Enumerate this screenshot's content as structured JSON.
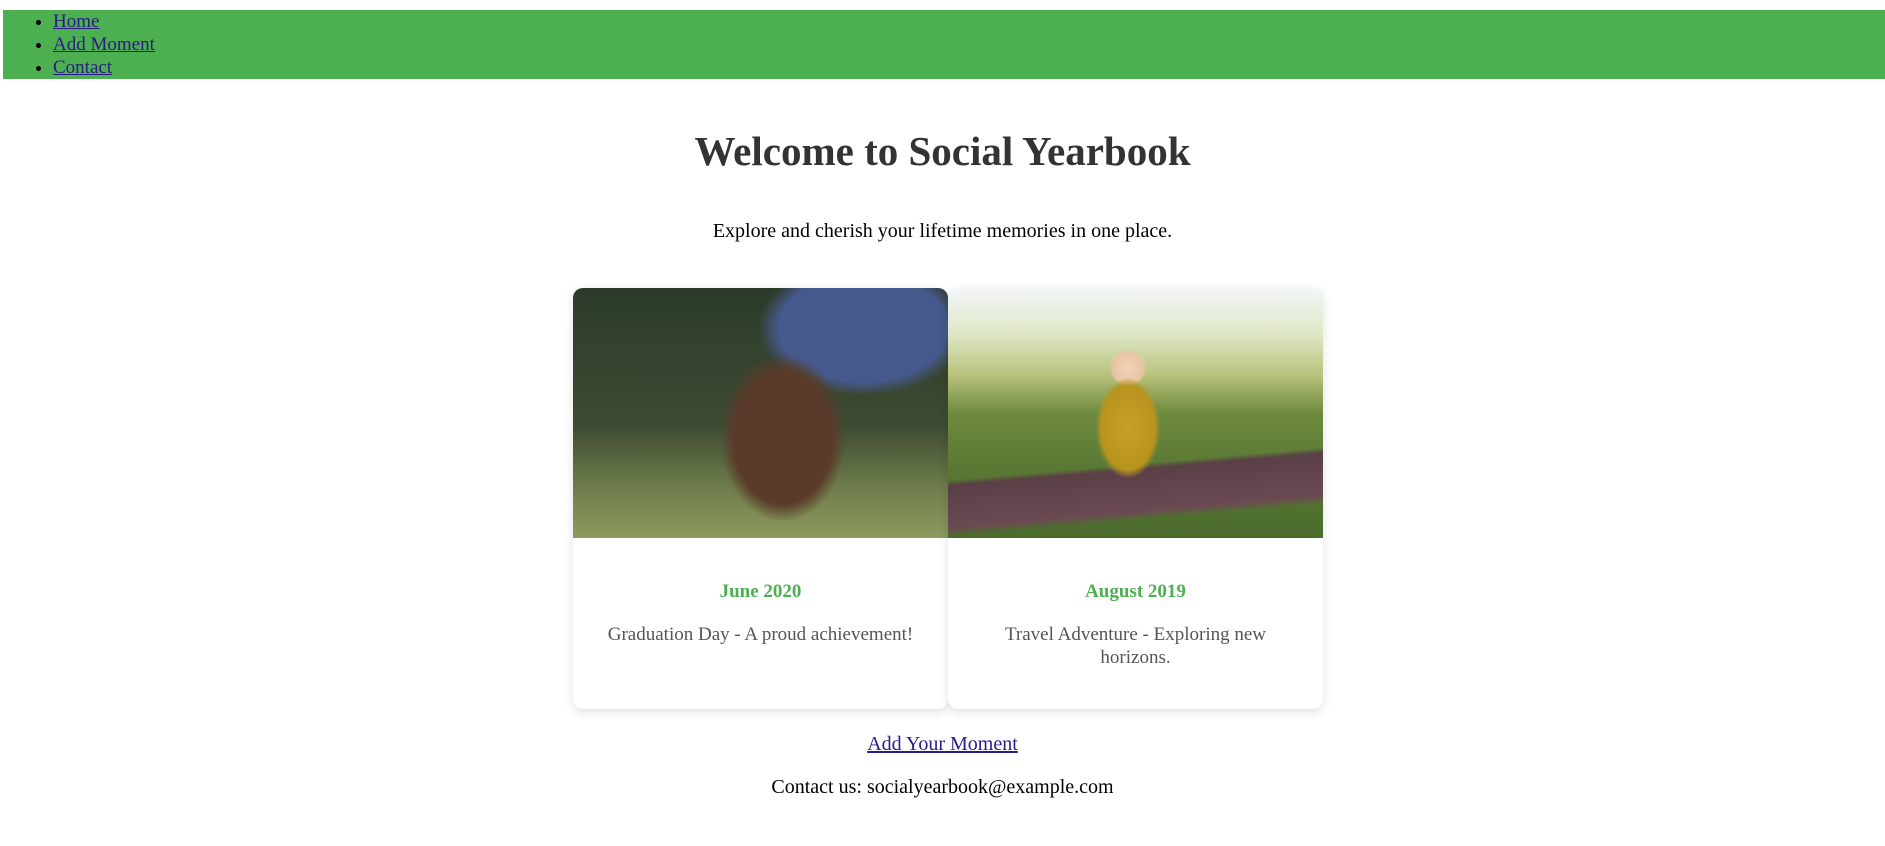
{
  "nav": {
    "items": [
      {
        "label": "Home"
      },
      {
        "label": "Add Moment"
      },
      {
        "label": "Contact"
      }
    ],
    "background_color": "#4caf50",
    "link_color": "#2b1a8a"
  },
  "header": {
    "title": "Welcome to Social Yearbook",
    "subtitle": "Explore and cherish your lifetime memories in one place."
  },
  "moments": [
    {
      "date": "June 2020",
      "description": "Graduation Day - A proud achievement!"
    },
    {
      "date": "August 2019",
      "description": "Travel Adventure - Exploring new horizons."
    }
  ],
  "footer": {
    "add_link": "Add Your Moment",
    "contact": "Contact us: socialyearbook@example.com"
  },
  "colors": {
    "accent": "#4caf50",
    "title": "#333333",
    "description": "#555555"
  }
}
